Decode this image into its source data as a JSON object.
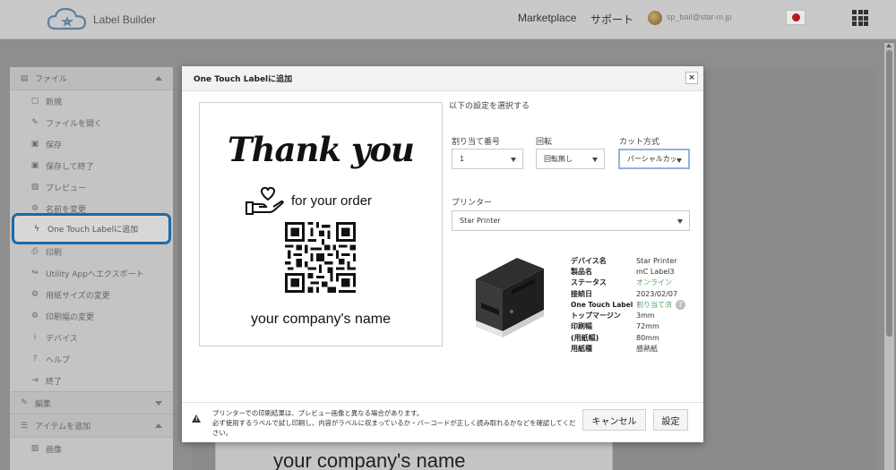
{
  "header": {
    "app_name": "Label Builder",
    "marketplace": "Marketplace",
    "support": "サポート",
    "email": "sp_bail@star-m.jp"
  },
  "sidebar": {
    "file_section": "ファイル",
    "items": [
      {
        "label": "新規",
        "icon": "new-file-icon"
      },
      {
        "label": "ファイルを開く",
        "icon": "open-file-icon"
      },
      {
        "label": "保存",
        "icon": "save-icon"
      },
      {
        "label": "保存して終了",
        "icon": "save-exit-icon"
      },
      {
        "label": "プレビュー",
        "icon": "preview-icon"
      },
      {
        "label": "名前を変更",
        "icon": "rename-icon"
      },
      {
        "label": "One Touch Labelに追加",
        "icon": "bolt-icon"
      },
      {
        "label": "印刷",
        "icon": "print-icon"
      },
      {
        "label": "Utility Appへエクスポート",
        "icon": "export-icon"
      },
      {
        "label": "用紙サイズの変更",
        "icon": "paper-size-icon"
      },
      {
        "label": "印刷幅の変更",
        "icon": "print-width-icon"
      },
      {
        "label": "デバイス",
        "icon": "device-icon"
      },
      {
        "label": "ヘルプ",
        "icon": "help-icon"
      },
      {
        "label": "終了",
        "icon": "exit-icon"
      }
    ],
    "edit_section": "編集",
    "add_item_section": "アイテムを追加",
    "image_item": "画像"
  },
  "background": {
    "preview_text": "your company's name"
  },
  "modal": {
    "title": "One Touch Labelに追加",
    "close": "×",
    "label": {
      "thank_you": "Thank you",
      "for_order": "for your order",
      "company": "your company's name"
    },
    "settings_title": "以下の設定を選択する",
    "assign_label": "割り当て番号",
    "assign_value": "1",
    "rotate_label": "回転",
    "rotate_value": "回転無し",
    "cut_label": "カット方式",
    "cut_value": "パーシャルカット",
    "printer_label": "プリンター",
    "printer_value": "Star Printer",
    "info": [
      {
        "key": "デバイス名",
        "value": "Star Printer"
      },
      {
        "key": "製品名",
        "value": "mC Label3"
      },
      {
        "key": "ステータス",
        "value": "オンライン"
      },
      {
        "key": "接続日",
        "value": "2023/02/07"
      },
      {
        "key": "One Touch Label",
        "value": "割り当て済"
      },
      {
        "key": "トップマージン",
        "value": "3mm"
      },
      {
        "key": "印刷幅",
        "value": "72mm"
      },
      {
        "key": "(用紙幅)",
        "value": "80mm"
      },
      {
        "key": "用紙種",
        "value": "感熱紙"
      }
    ],
    "notice_line1": "プリンターでの印刷結果は、プレビュー画像と異なる場合があります。",
    "notice_line2": "必ず使用するラベルで試し印刷し、内容がラベルに収まっているか・バーコードが正しく読み取れるかなどを確認してください。",
    "cancel_button": "キャンセル",
    "set_button": "設定"
  },
  "colors": {
    "highlight": "#1c6aa7",
    "online": "#5aa36b"
  }
}
